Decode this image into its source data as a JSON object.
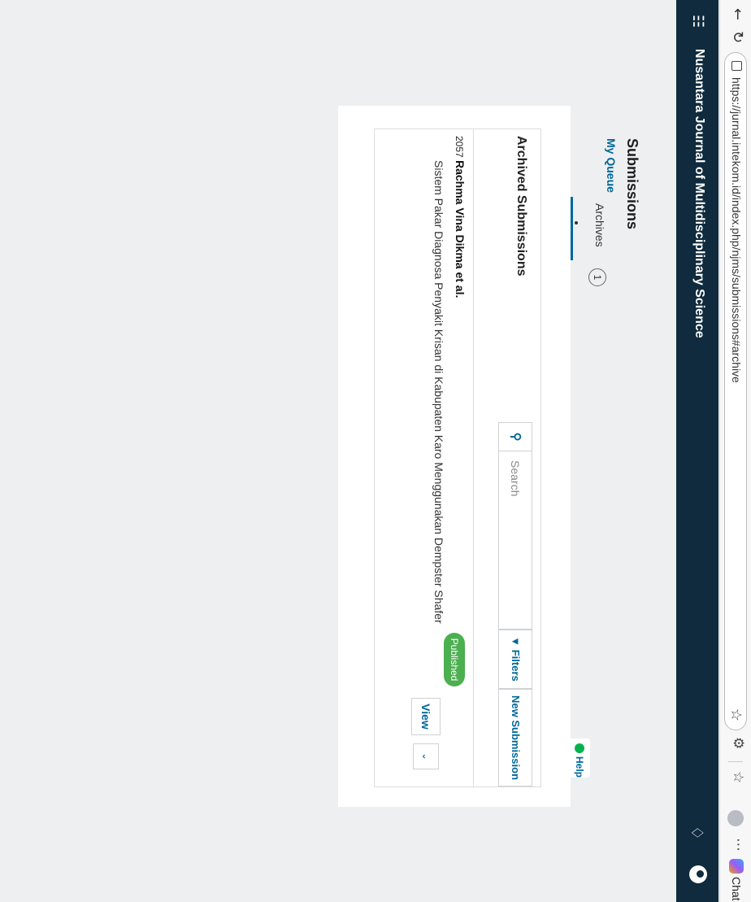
{
  "browser": {
    "back_icon": "arrow-left-icon",
    "reload_icon": "reload-icon",
    "url": "https://jurnal.intekom.id/index.php/njms/submissions#archive",
    "chat_label": "Chat"
  },
  "header": {
    "journal_title": "Nusantara Journal of Multidisciplinary Science",
    "background": "#0f2b3d"
  },
  "page": {
    "title": "Submissions",
    "tabs": [
      {
        "label": "My Queue"
      },
      {
        "label": "Archives",
        "count": "1"
      }
    ],
    "help_label": "Help"
  },
  "archive": {
    "heading": "Archived Submissions",
    "search_placeholder": "Search",
    "filters_label": "Filters",
    "new_submission_label": "New Submission",
    "items": [
      {
        "id": "2057",
        "author": "Rachma Vina Dikma et al.",
        "title": "Sistem Pakar Diagnosa Penyakit Krisan di Kabupaten Karo Menggunakan Dempster Shafer",
        "status": "Published",
        "view_label": "View",
        "expand_icon": "chevron-down-icon"
      }
    ]
  },
  "colors": {
    "accent": "#006798",
    "published": "#4caf50",
    "help": "#00b24e"
  }
}
